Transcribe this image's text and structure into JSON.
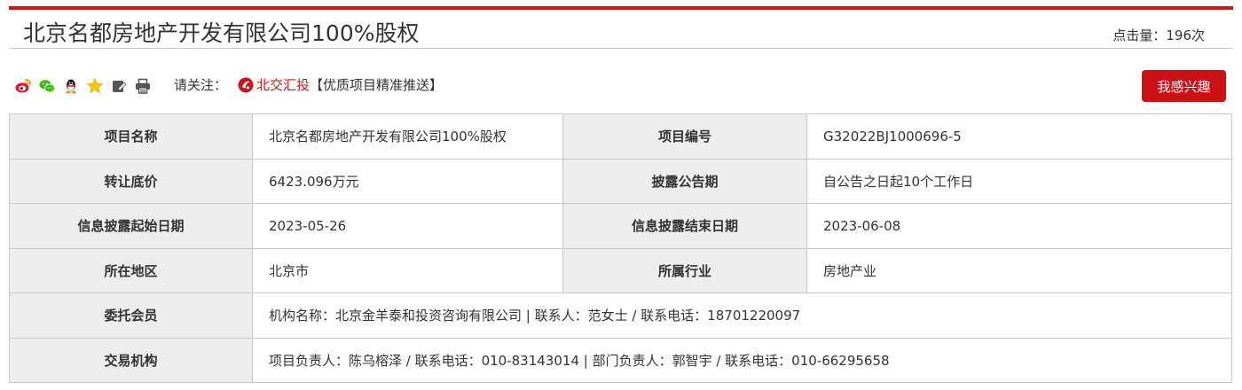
{
  "header": {
    "title": "北京名都房地产开发有限公司100%股权",
    "views": "点击量：196次"
  },
  "share": {
    "icons": [
      "weibo-icon",
      "wechat-icon",
      "qq-icon",
      "favorite-star-icon",
      "edit-icon",
      "print-icon"
    ],
    "follow_label": "请关注：",
    "brand": "北交汇投",
    "promo": "【优质项目精准推送】"
  },
  "interest_button": "我感兴趣",
  "table": {
    "project_name_label": "项目名称",
    "project_name": "北京名都房地产开发有限公司100%股权",
    "project_code_label": "项目编号",
    "project_code": "G32022BJ1000696-5",
    "price_label": "转让底价",
    "price": "6423.096万元",
    "disclosure_period_label": "披露公告期",
    "disclosure_period": "自公告之日起10个工作日",
    "start_date_label": "信息披露起始日期",
    "start_date": "2023-05-26",
    "end_date_label": "信息披露结束日期",
    "end_date": "2023-06-08",
    "region_label": "所在地区",
    "region": "北京市",
    "industry_label": "所属行业",
    "industry": "房地产业",
    "member_label": "委托会员",
    "member": "机构名称：北京金羊泰和投资咨询有限公司 | 联系人：范女士 / 联系电话：18701220097",
    "agency_label": "交易机构",
    "agency": "项目负责人：陈乌榕泽 / 联系电话：010-83143014 | 部门负责人：郭智宇 / 联系电话：010-66295658"
  },
  "colors": {
    "accent": "#c8161d",
    "button": "#cc1114",
    "label_bg": "#ededed",
    "border": "#c9c9c9"
  }
}
